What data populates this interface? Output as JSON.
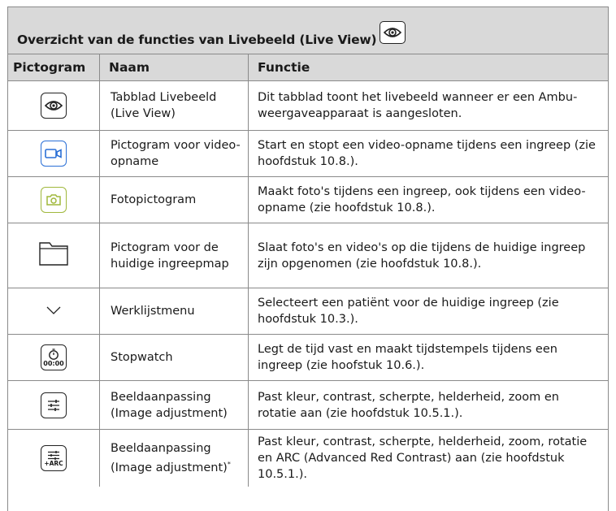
{
  "title": "Overzicht van de functies van Livebeeld (Live View)",
  "headers": {
    "icon": "Pictogram",
    "name": "Naam",
    "function": "Functie"
  },
  "rows": [
    {
      "icon": "eye-icon",
      "name": "Tabblad Livebeeld (Live View)",
      "function": "Dit tabblad toont het livebeeld wanneer er een Ambu-weergaveapparaat is aangesloten."
    },
    {
      "icon": "video-camera-icon",
      "name": "Pictogram voor video-opname",
      "function": "Start en stopt een video-opname tijdens een ingreep (zie hoofdstuk 10.8.)."
    },
    {
      "icon": "photo-camera-icon",
      "name": "Fotopictogram",
      "function": "Maakt foto's tijdens een ingreep, ook tijdens een video-opname (zie hoofdstuk 10.8.)."
    },
    {
      "icon": "folder-icon",
      "name": "Pictogram voor de huidige ingreepmap",
      "function": "Slaat foto's en video's op die tijdens de huidige ingreep zijn opgenomen (zie hoofdstuk 10.8.)."
    },
    {
      "icon": "chevron-down-icon",
      "name": "Werklijstmenu",
      "function": "Selecteert een patiënt voor de huidige ingreep (zie hoofdstuk 10.3.)."
    },
    {
      "icon": "stopwatch-icon",
      "name": "Stopwatch",
      "function": "Legt de tijd vast en maakt tijdstempels tijdens een ingreep (zie hoofstuk 10.6.)."
    },
    {
      "icon": "sliders-icon",
      "name": "Beeldaanpassing (Image adjustment)",
      "function": "Past kleur, contrast, scherpte, helderheid, zoom en rotatie aan (zie hoofdstuk 10.5.1.)."
    },
    {
      "icon": "sliders-arc-icon",
      "name": "Beeldaanpassing (Image adjustment)",
      "name_sup": "*",
      "function": "Past kleur, contrast, scherpte, helderheid, zoom, rotatie en ARC (Advanced Red Contrast) aan (zie hoofdstuk 10.5.1.)."
    }
  ],
  "stopwatch_text": "00:00",
  "arc_text": "+ARC",
  "colors": {
    "header_bg": "#d9d9d9",
    "border": "#8a8a8a",
    "video_blue": "#2a6fd6",
    "photo_green": "#a0b83c"
  }
}
